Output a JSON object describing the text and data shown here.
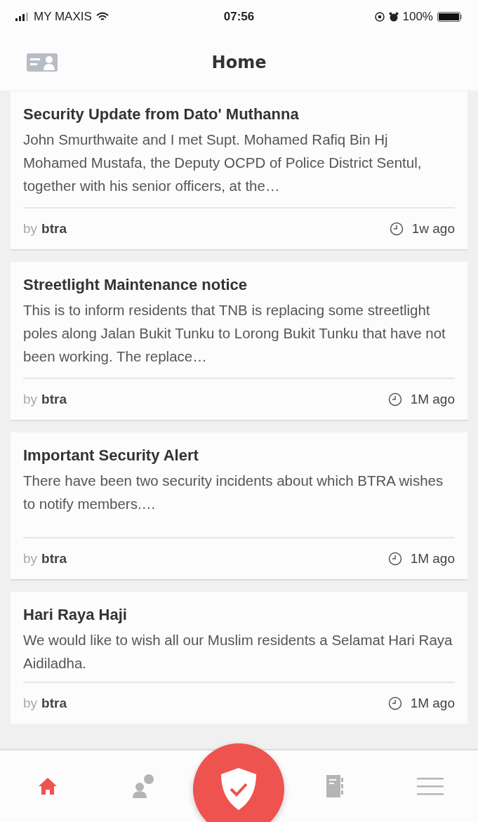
{
  "status_bar": {
    "carrier": "MY MAXIS",
    "time": "07:56",
    "battery": "100%"
  },
  "header": {
    "title": "Home"
  },
  "posts": [
    {
      "title": "Security Update from Dato' Muthanna",
      "body": "John Smurthwaite and I met Supt. Mohamed Rafiq Bin Hj Mohamed Mustafa, the Deputy OCPD of Police District Sentul, together with his senior officers, at the…",
      "by": "by",
      "author": "btra",
      "time": "1w ago"
    },
    {
      "title": "Streetlight Maintenance notice",
      "body": "This is to inform residents that TNB is replacing some streetlight poles along Jalan Bukit Tunku to Lorong Bukit Tunku that have not been working. The replace…",
      "by": "by",
      "author": "btra",
      "time": "1M ago"
    },
    {
      "title": "Important Security Alert",
      "body": "There have been two security incidents about which BTRA wishes to notify members.…",
      "by": "by",
      "author": "btra",
      "time": "1M ago"
    },
    {
      "title": "Hari Raya Haji",
      "body": "We would like to wish all our Muslim residents a Selamat Hari Raya Aidiladha.",
      "by": "by",
      "author": "btra",
      "time": "1M ago"
    }
  ],
  "tab_bar": [
    {
      "kind": "home",
      "selected": true
    },
    {
      "kind": "chat",
      "selected": false
    },
    {
      "kind": "shield",
      "selected": false
    },
    {
      "kind": "notebook",
      "selected": false
    },
    {
      "kind": "menu",
      "selected": false
    }
  ]
}
